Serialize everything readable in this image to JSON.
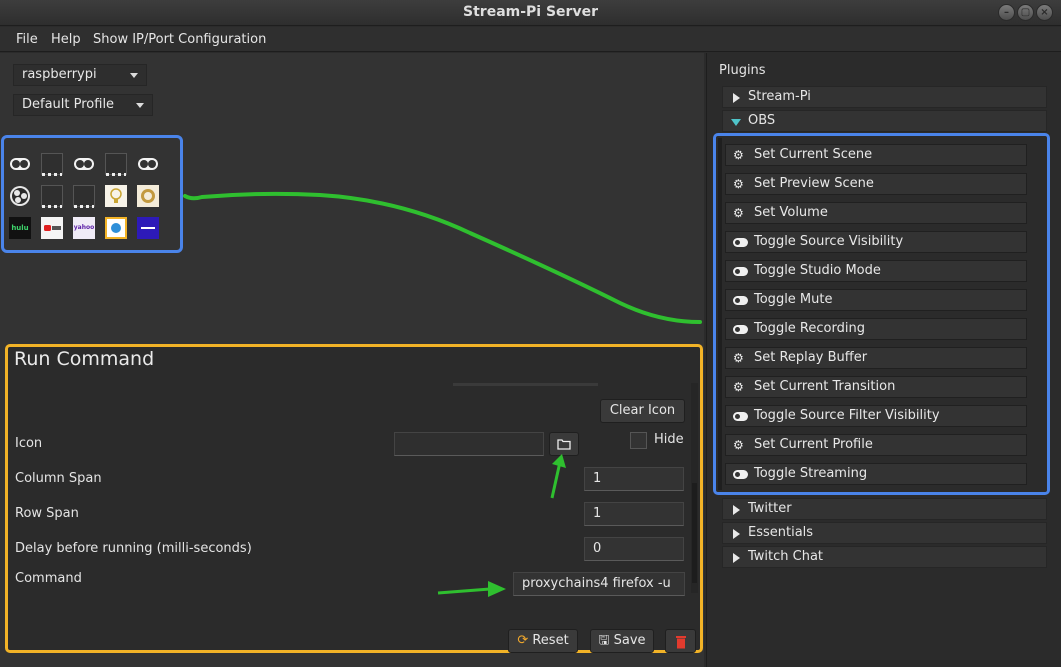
{
  "window": {
    "title": "Stream-Pi Server"
  },
  "menu": {
    "file": "File",
    "help": "Help",
    "ipconfig": "Show IP/Port Configuration"
  },
  "client_select": {
    "value": "raspberrypi"
  },
  "profile_select": {
    "value": "Default Profile"
  },
  "action_grid": {
    "cells": [
      {
        "row": 0,
        "col": 0,
        "icon": "toggle-icon"
      },
      {
        "row": 0,
        "col": 1,
        "icon": "blank-icon"
      },
      {
        "row": 0,
        "col": 2,
        "icon": "toggle-icon"
      },
      {
        "row": 0,
        "col": 3,
        "icon": "blank-icon"
      },
      {
        "row": 0,
        "col": 4,
        "icon": "toggle-icon"
      },
      {
        "row": 1,
        "col": 0,
        "icon": "obs-icon"
      },
      {
        "row": 1,
        "col": 1,
        "icon": "blank-icon"
      },
      {
        "row": 1,
        "col": 2,
        "icon": "blank-icon"
      },
      {
        "row": 1,
        "col": 3,
        "icon": "lightbulb-icon"
      },
      {
        "row": 1,
        "col": 4,
        "icon": "badge-icon"
      },
      {
        "row": 2,
        "col": 0,
        "icon": "hulu-icon"
      },
      {
        "row": 2,
        "col": 1,
        "icon": "youtube-icon"
      },
      {
        "row": 2,
        "col": 2,
        "icon": "yahoo-icon"
      },
      {
        "row": 2,
        "col": 3,
        "icon": "weather-icon"
      },
      {
        "row": 2,
        "col": 4,
        "icon": "blue-app-icon"
      }
    ],
    "colors": {
      "highlight": "#4a84ea"
    }
  },
  "properties": {
    "title": "Run Command",
    "clear_icon": "Clear Icon",
    "hide_label": "Hide",
    "icon_label": "Icon",
    "column_span_label": "Column Span",
    "column_span_value": "1",
    "row_span_label": "Row Span",
    "row_span_value": "1",
    "delay_label": "Delay before running (milli-seconds)",
    "delay_value": "0",
    "command_label": "Command",
    "command_value": "proxychains4 firefox  -u",
    "reset": "Reset",
    "save": "Save"
  },
  "plugins": {
    "title": "Plugins",
    "categories": [
      "Stream-Pi",
      "OBS",
      "Twitter",
      "Essentials",
      "Twitch Chat"
    ],
    "obs_actions": [
      {
        "label": "Set Current Scene",
        "icon": "gears"
      },
      {
        "label": "Set Preview Scene",
        "icon": "gears"
      },
      {
        "label": "Set Volume",
        "icon": "gears"
      },
      {
        "label": "Toggle Source Visibility",
        "icon": "toggle"
      },
      {
        "label": "Toggle Studio Mode",
        "icon": "toggle"
      },
      {
        "label": "Toggle Mute",
        "icon": "toggle"
      },
      {
        "label": "Toggle Recording",
        "icon": "toggle"
      },
      {
        "label": "Set Replay Buffer",
        "icon": "gears"
      },
      {
        "label": "Set Current Transition",
        "icon": "gears"
      },
      {
        "label": "Toggle Source Filter Visibility",
        "icon": "toggle"
      },
      {
        "label": "Set Current Profile",
        "icon": "gears"
      },
      {
        "label": "Toggle Streaming",
        "icon": "toggle"
      }
    ]
  },
  "annotations": {
    "arrow_color": "#2fbf2f",
    "highlight_yellow": "#f2b327",
    "highlight_blue": "#4a84ea"
  }
}
